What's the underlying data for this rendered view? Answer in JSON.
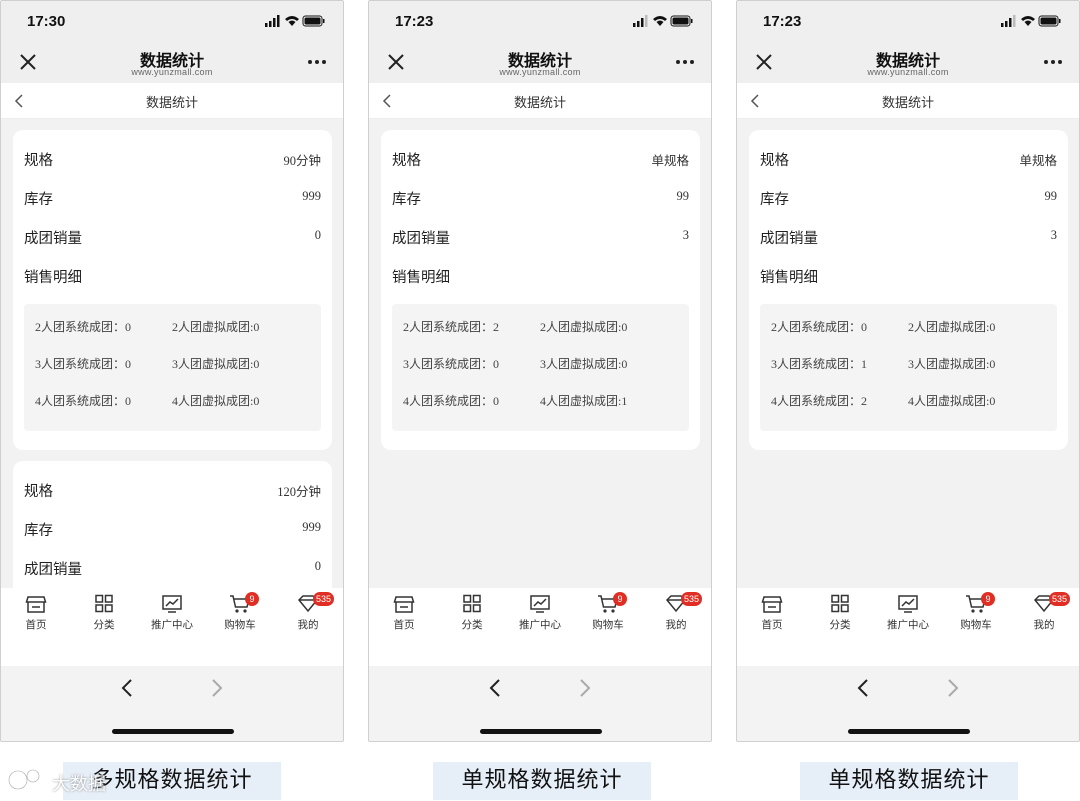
{
  "phones": [
    {
      "time": "17:30",
      "title": "数据统计",
      "domain": "www.yunzmall.com",
      "nav_title": "数据统计",
      "cards": [
        {
          "spec_label": "规格",
          "spec_value": "90分钟",
          "stock_label": "库存",
          "stock_value": "999",
          "sales_label": "成团销量",
          "sales_value": "0",
          "detail_label": "销售明细",
          "detail": [
            [
              "2人团系统成团：0",
              "2人团虚拟成团:0"
            ],
            [
              "3人团系统成团：0",
              "3人团虚拟成团:0"
            ],
            [
              "4人团系统成团：0",
              "4人团虚拟成团:0"
            ]
          ]
        },
        {
          "spec_label": "规格",
          "spec_value": "120分钟",
          "stock_label": "库存",
          "stock_value": "999",
          "sales_label": "成团销量",
          "sales_value": "0"
        }
      ]
    },
    {
      "time": "17:23",
      "title": "数据统计",
      "domain": "www.yunzmall.com",
      "nav_title": "数据统计",
      "cards": [
        {
          "spec_label": "规格",
          "spec_value": "单规格",
          "stock_label": "库存",
          "stock_value": "99",
          "sales_label": "成团销量",
          "sales_value": "3",
          "detail_label": "销售明细",
          "detail": [
            [
              "2人团系统成团：2",
              "2人团虚拟成团:0"
            ],
            [
              "3人团系统成团：0",
              "3人团虚拟成团:0"
            ],
            [
              "4人团系统成团：0",
              "4人团虚拟成团:1"
            ]
          ]
        }
      ]
    },
    {
      "time": "17:23",
      "title": "数据统计",
      "domain": "www.yunzmall.com",
      "nav_title": "数据统计",
      "cards": [
        {
          "spec_label": "规格",
          "spec_value": "单规格",
          "stock_label": "库存",
          "stock_value": "99",
          "sales_label": "成团销量",
          "sales_value": "3",
          "detail_label": "销售明细",
          "detail": [
            [
              "2人团系统成团：0",
              "2人团虚拟成团:0"
            ],
            [
              "3人团系统成团：1",
              "3人团虚拟成团:0"
            ],
            [
              "4人团系统成团：2",
              "4人团虚拟成团:0"
            ]
          ]
        }
      ]
    }
  ],
  "tabbar": {
    "home": "首页",
    "category": "分类",
    "promo": "推广中心",
    "cart": "购物车",
    "cart_badge": "9",
    "mine": "我的",
    "mine_badge": "535"
  },
  "captions": [
    "多规格数据统计",
    "单规格数据统计",
    "单规格数据统计"
  ],
  "watermark": "大数据",
  "colors": {
    "badge": "#e02e24",
    "caption_bg": "#e6eef8",
    "page_bg": "#f2f2f2"
  }
}
